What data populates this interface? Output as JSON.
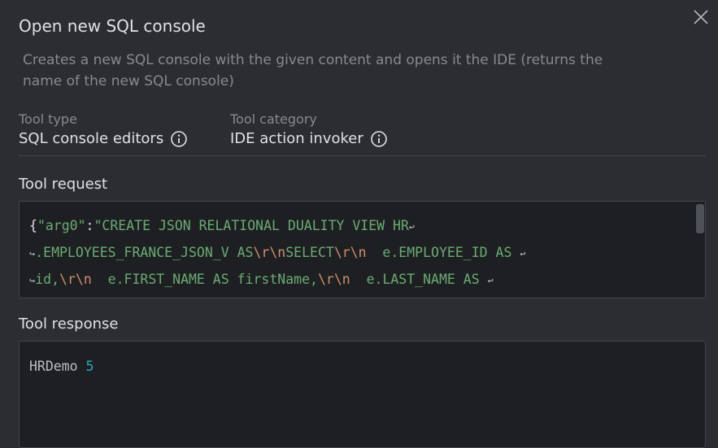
{
  "dialog": {
    "title": "Open new SQL console",
    "description": "Creates a new SQL console with the given content and opens it the IDE (returns the name of the new SQL console)",
    "tool_type_label": "Tool type",
    "tool_type_value": "SQL console editors",
    "tool_category_label": "Tool category",
    "tool_category_value": "IDE action invoker",
    "request_label": "Tool request",
    "response_label": "Tool response"
  },
  "request": {
    "line1_brace": "{",
    "line1_key": "\"arg0\"",
    "line1_colon": ":",
    "line1_str": "\"CREATE JSON RELATIONAL DUALITY VIEW HR",
    "line2_str_a": ".EMPLOYEES_FRANCE_JSON_V AS",
    "line2_esc_a": "\\r\\n",
    "line2_str_b": "SELECT",
    "line2_esc_b": "\\r\\n",
    "line2_str_c": "  e.EMPLOYEE_ID AS ",
    "line3_str_a": "id,",
    "line3_esc_a": "\\r\\n",
    "line3_str_b": "  e.FIRST_NAME AS firstName,",
    "line3_esc_b": "\\r\\n",
    "line3_str_c": "  e.LAST_NAME AS "
  },
  "response": {
    "name": "HRDemo",
    "number": "5"
  },
  "icons": {
    "close": "close-icon",
    "info": "info-icon",
    "wrap": "soft-wrap-icon"
  },
  "colors": {
    "background": "#2b2d30",
    "editor_bg": "#1e1f22",
    "string": "#6aab73",
    "escape": "#cf8e6d",
    "number": "#2aacb8"
  }
}
